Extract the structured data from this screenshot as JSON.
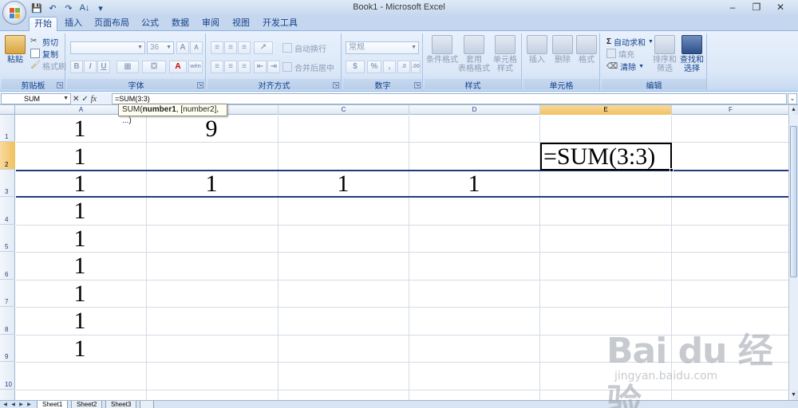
{
  "window": {
    "title": "Book1 - Microsoft Excel",
    "minimize": "–",
    "restore": "❐",
    "close": "✕"
  },
  "qat": {
    "save": "💾",
    "undo": "↶",
    "redo": "↷",
    "sort": "A↓",
    "more": "▾"
  },
  "tabs": [
    {
      "label": "开始",
      "active": true
    },
    {
      "label": "插入"
    },
    {
      "label": "页面布局"
    },
    {
      "label": "公式"
    },
    {
      "label": "数据"
    },
    {
      "label": "审阅"
    },
    {
      "label": "视图"
    },
    {
      "label": "开发工具"
    }
  ],
  "ribbon": {
    "clipboard": {
      "label": "剪贴板",
      "paste": "粘贴",
      "cut": "剪切",
      "copy": "复制",
      "format_painter": "格式刷"
    },
    "font": {
      "label": "字体",
      "name": "",
      "size": "36",
      "bold": "B",
      "italic": "I",
      "underline": "U",
      "grow": "A",
      "shrink": "A",
      "color": "A",
      "phonetic": "wén"
    },
    "alignment": {
      "label": "对齐方式",
      "wrap": "自动换行",
      "merge": "合并后居中"
    },
    "number": {
      "label": "数字",
      "format": "常规",
      "percent": "%",
      "comma": ","
    },
    "styles": {
      "label": "样式",
      "conditional": "条件格式",
      "table": "套用\n表格格式",
      "cell_styles": "单元格\n样式"
    },
    "cells": {
      "label": "单元格",
      "insert": "插入",
      "delete": "删除",
      "format": "格式"
    },
    "editing": {
      "label": "编辑",
      "autosum": "自动求和",
      "fill": "填充",
      "clear": "清除",
      "sort_filter": "排序和\n筛选",
      "find_select": "查找和\n选择"
    }
  },
  "formula_bar": {
    "name_box": "SUM",
    "cancel": "✕",
    "enter": "✓",
    "fx": "fx",
    "formula": "=SUM(3:3)"
  },
  "tooltip": {
    "fn": "SUM(",
    "arg1": "number1",
    "rest": ", [number2], ...)"
  },
  "columns": [
    "A",
    "B",
    "C",
    "D",
    "E",
    "F"
  ],
  "rows": [
    "1",
    "2",
    "3",
    "4",
    "5",
    "6",
    "7",
    "8",
    "9",
    "10"
  ],
  "cells": {
    "A1": "1",
    "B1": "9",
    "A2": "1",
    "A3": "1",
    "B3": "1",
    "C3": "1",
    "D3": "1",
    "A4": "1",
    "A5": "1",
    "A6": "1",
    "A7": "1",
    "A8": "1",
    "A9": "1"
  },
  "active_cell_text": "=SUM(3:3)",
  "sheets": [
    {
      "name": "Sheet1",
      "active": true
    },
    {
      "name": "Sheet2"
    },
    {
      "name": "Sheet3"
    }
  ],
  "watermark": {
    "logo": "Bai  du 经验",
    "url": "jingyan.baidu.com"
  }
}
